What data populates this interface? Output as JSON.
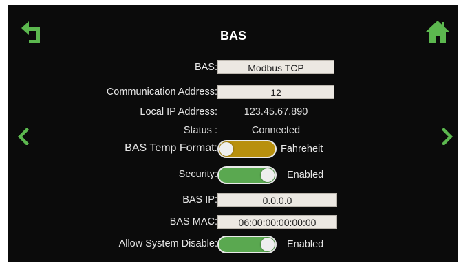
{
  "header": {
    "title": "BAS",
    "back_icon": "back-arrow-icon",
    "home_icon": "home-icon"
  },
  "nav": {
    "prev_icon": "chevron-left-icon",
    "next_icon": "chevron-right-icon"
  },
  "colors": {
    "background": "#0b0b0b",
    "accent_green": "#5aa850",
    "toggle_gold": "#b8900e",
    "field_bg": "#ece8e2"
  },
  "settings": {
    "bas": {
      "label": "BAS:",
      "value": "Modbus TCP"
    },
    "comm_address": {
      "label": "Communication Address:",
      "value": "12"
    },
    "local_ip": {
      "label": "Local IP Address:",
      "value": "123.45.67.890"
    },
    "status": {
      "label": "Status :",
      "value": "Connected"
    },
    "temp_format": {
      "label": "BAS Temp Format:",
      "value": "Fahreheit"
    },
    "security": {
      "label": "Security:",
      "value": "Enabled"
    },
    "bas_ip": {
      "label": "BAS IP:",
      "value": "0.0.0.0"
    },
    "bas_mac": {
      "label": "BAS MAC:",
      "value": "06:00:00:00:00:00"
    },
    "allow_disable": {
      "label": "Allow System Disable:",
      "value": "Enabled"
    }
  }
}
